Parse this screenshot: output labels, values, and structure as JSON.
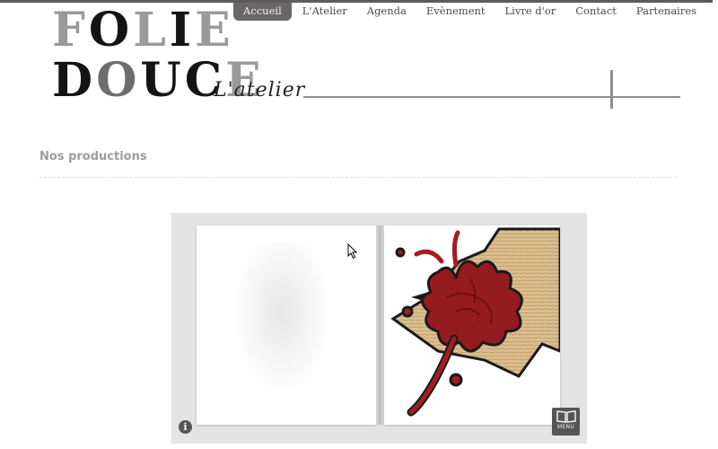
{
  "nav": {
    "items": [
      {
        "label": "Accueil",
        "active": true
      },
      {
        "label": "L'Atelier"
      },
      {
        "label": "Agenda"
      },
      {
        "label": "Evènement"
      },
      {
        "label": "Livre d'or"
      },
      {
        "label": "Contact"
      },
      {
        "label": "Partenaires"
      }
    ]
  },
  "logo": {
    "line1": "FOLIE",
    "line2": "DOUCE",
    "signature": "L'atelier"
  },
  "main": {
    "section_title": "Nos productions"
  },
  "viewer": {
    "info_icon": "info-icon",
    "menu_icon": "book-icon",
    "menu_label": "MENU"
  },
  "colors": {
    "nav_active_bg": "#6b6769",
    "top_border": "#5d5a5e",
    "illustration_red": "#9c1b1f",
    "illustration_wood": "#d9b98a"
  }
}
